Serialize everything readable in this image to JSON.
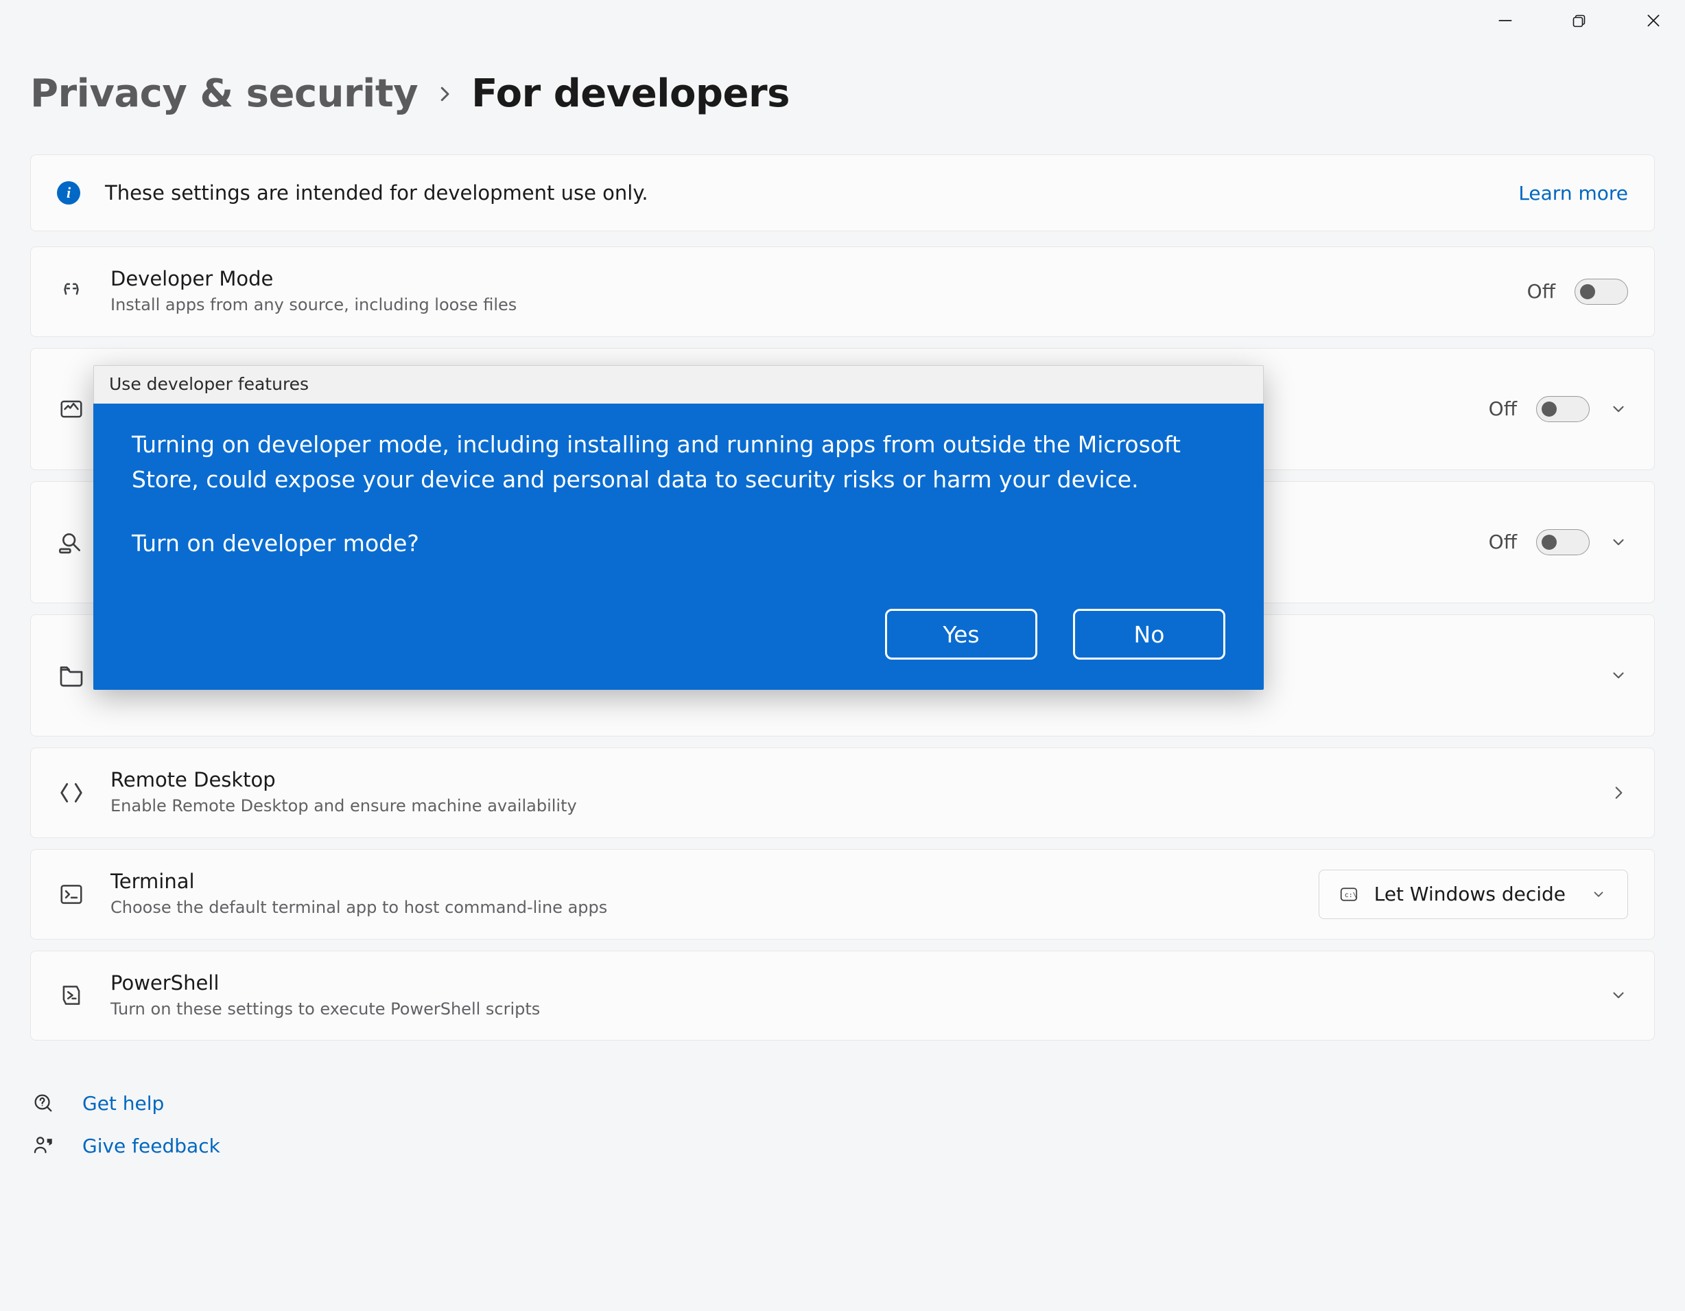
{
  "breadcrumb": {
    "parent": "Privacy & security",
    "title": "For developers"
  },
  "info_banner": {
    "text": "These settings are intended for development use only.",
    "link_label": "Learn more"
  },
  "cards": {
    "developer_mode": {
      "title": "Developer Mode",
      "subtitle": "Install apps from any source, including loose files",
      "toggle_label": "Off"
    },
    "row2": {
      "toggle_label": "Off"
    },
    "row3": {
      "toggle_label": "Off"
    },
    "remote_desktop": {
      "title": "Remote Desktop",
      "subtitle": "Enable Remote Desktop and ensure machine availability"
    },
    "terminal": {
      "title": "Terminal",
      "subtitle": "Choose the default terminal app to host command-line apps",
      "dropdown_label": "Let Windows decide"
    },
    "powershell": {
      "title": "PowerShell",
      "subtitle": "Turn on these settings to execute PowerShell scripts"
    }
  },
  "footer": {
    "help": "Get help",
    "feedback": "Give feedback"
  },
  "dialog": {
    "title": "Use developer features",
    "body": "Turning on developer mode, including installing and running apps from outside the Microsoft Store, could expose your device and personal data to security risks or harm your device.",
    "question": "Turn on developer mode?",
    "yes": "Yes",
    "no": "No"
  }
}
